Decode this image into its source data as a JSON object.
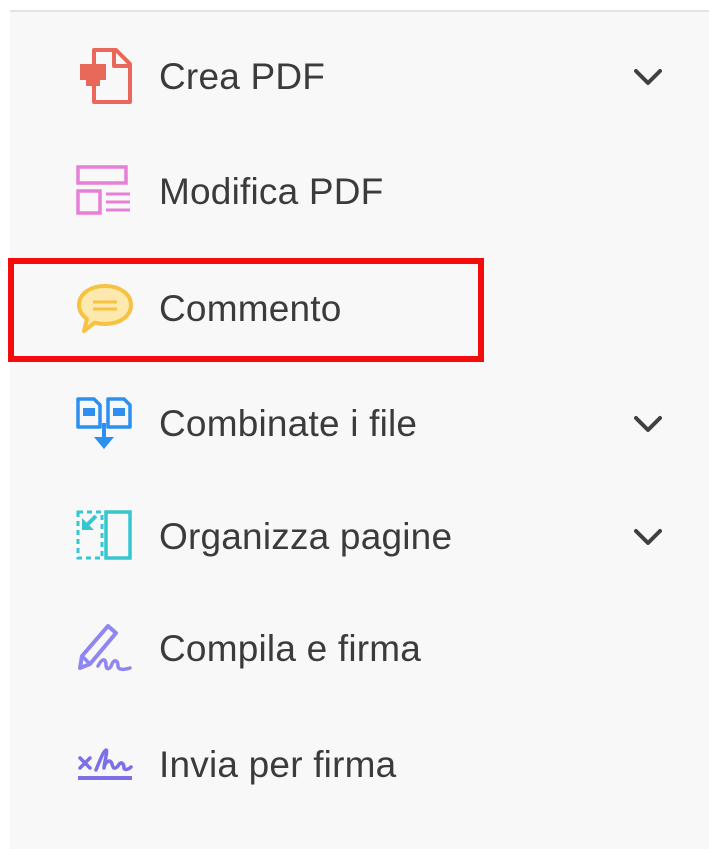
{
  "menu": {
    "items": [
      {
        "label": "Crea PDF",
        "icon": "create-pdf-icon",
        "has_chevron": true
      },
      {
        "label": "Modifica PDF",
        "icon": "edit-pdf-icon",
        "has_chevron": false
      },
      {
        "label": "Commento",
        "icon": "comment-icon",
        "has_chevron": false,
        "highlighted": true
      },
      {
        "label": "Combinate i file",
        "icon": "combine-files-icon",
        "has_chevron": true
      },
      {
        "label": "Organizza pagine",
        "icon": "organize-pages-icon",
        "has_chevron": true
      },
      {
        "label": "Compila e firma",
        "icon": "fill-sign-icon",
        "has_chevron": false
      },
      {
        "label": "Invia per firma",
        "icon": "send-for-signature-icon",
        "has_chevron": false
      }
    ],
    "chevron_icon": "chevron-down-icon"
  },
  "colors": {
    "panel_background": "#f8f8f8",
    "label_text": "#3b3b3b",
    "highlight_border": "#f40c0c",
    "create_pdf": "#e8685a",
    "edit_pdf": "#e67fd8",
    "comment": "#f5c242",
    "combine_files": "#2d8ff0",
    "organize_pages": "#35c6cf",
    "fill_sign": "#8f86f2",
    "send_for_signature": "#7b70ea"
  }
}
